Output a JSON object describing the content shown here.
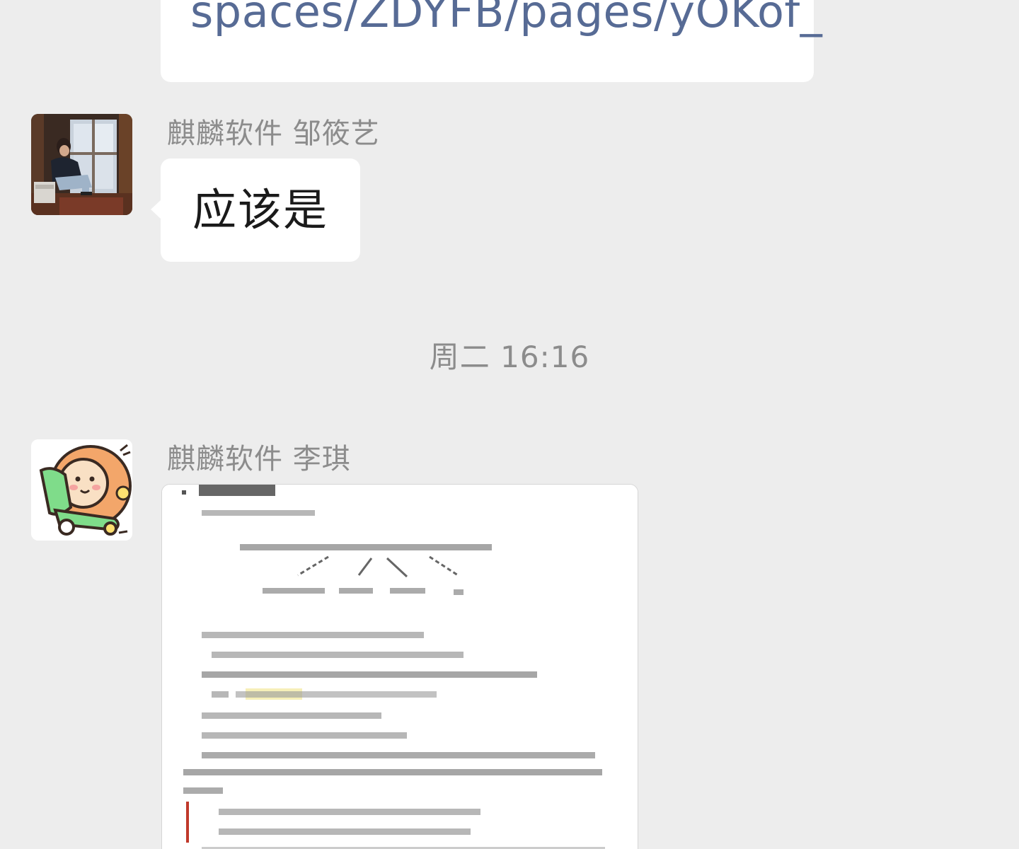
{
  "messages": {
    "link_message": {
      "text": "spaces/ZDYFB/pages/yOKof_"
    },
    "message_1": {
      "sender": "麒麟软件 邹筱艺",
      "text": "应该是",
      "avatar_icon": "photo-avatar-person-by-window"
    },
    "timestamp": "周二 16:16",
    "message_2": {
      "sender": "麒麟软件 李琪",
      "avatar_icon": "cartoon-sticker-avatar",
      "image": "document-screenshot-thumbnail"
    }
  },
  "colors": {
    "background": "#ededed",
    "bubble": "#ffffff",
    "link": "#576b95",
    "meta_text": "#8c8c8c"
  }
}
